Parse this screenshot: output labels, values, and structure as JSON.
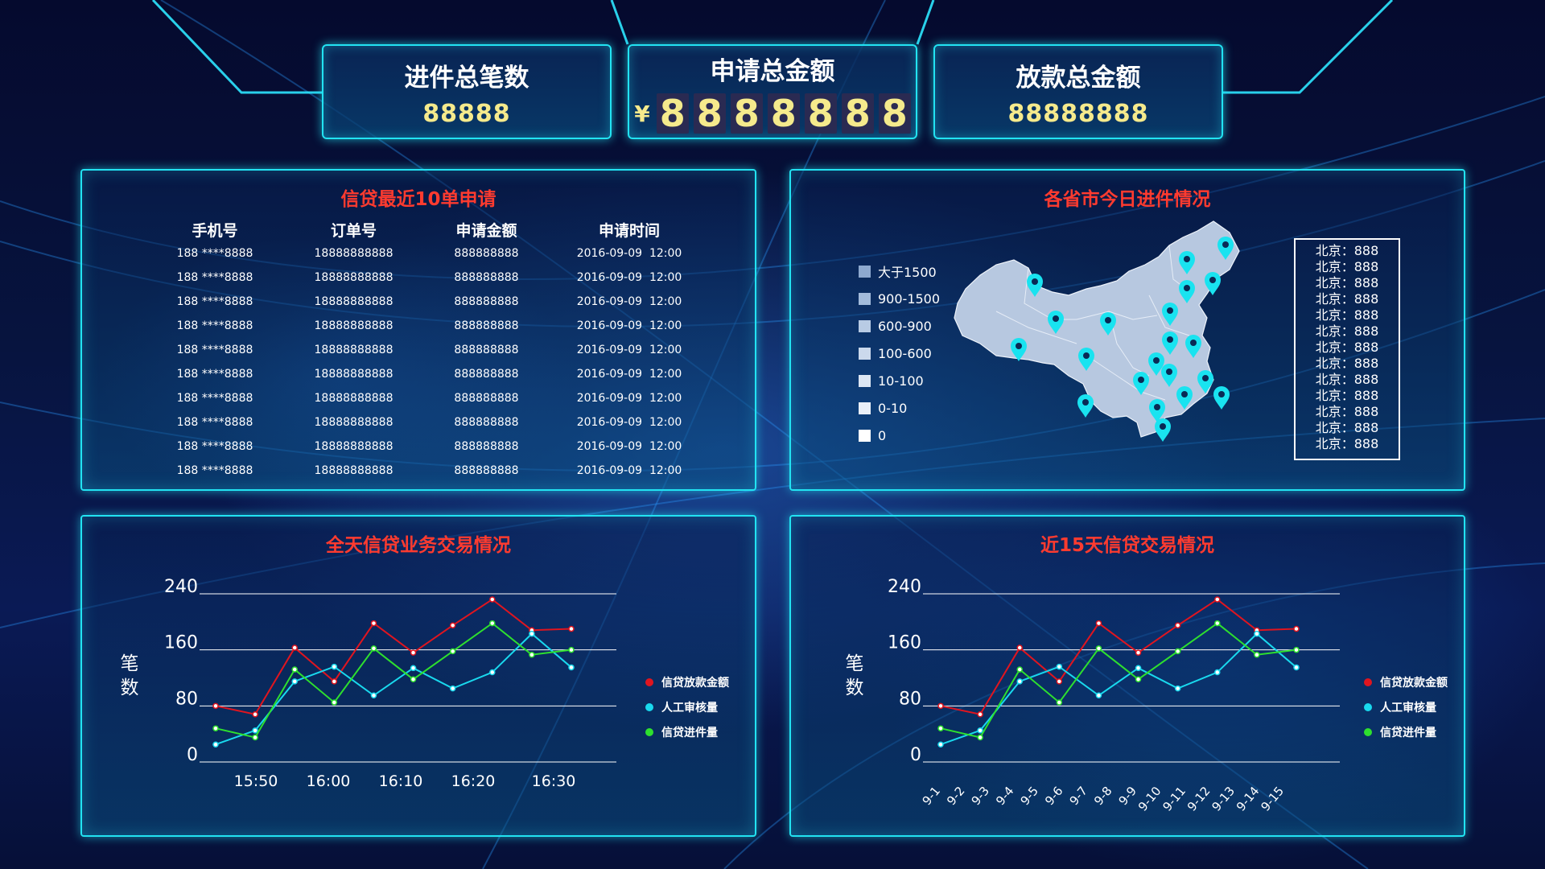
{
  "kpis": {
    "total_count": {
      "title": "进件总笔数",
      "value": "88888"
    },
    "apply_amount": {
      "title": "申请总金额",
      "currency": "¥",
      "digits": [
        "8",
        "8",
        "8",
        "8",
        "8",
        "8",
        "8"
      ]
    },
    "loan_amount": {
      "title": "放款总金额",
      "value": "88888888"
    }
  },
  "recent_table": {
    "title": "信贷最近10单申请",
    "headers": [
      "手机号",
      "订单号",
      "申请金额",
      "申请时间"
    ],
    "rows": [
      [
        "188 ****8888",
        "18888888888",
        "888888888",
        "2016-09-09  12:00"
      ],
      [
        "188 ****8888",
        "18888888888",
        "888888888",
        "2016-09-09  12:00"
      ],
      [
        "188 ****8888",
        "18888888888",
        "888888888",
        "2016-09-09  12:00"
      ],
      [
        "188 ****8888",
        "18888888888",
        "888888888",
        "2016-09-09  12:00"
      ],
      [
        "188 ****8888",
        "18888888888",
        "888888888",
        "2016-09-09  12:00"
      ],
      [
        "188 ****8888",
        "18888888888",
        "888888888",
        "2016-09-09  12:00"
      ],
      [
        "188 ****8888",
        "18888888888",
        "888888888",
        "2016-09-09  12:00"
      ],
      [
        "188 ****8888",
        "18888888888",
        "888888888",
        "2016-09-09  12:00"
      ],
      [
        "188 ****8888",
        "18888888888",
        "888888888",
        "2016-09-09  12:00"
      ],
      [
        "188 ****8888",
        "18888888888",
        "888888888",
        "2016-09-09  12:00"
      ]
    ]
  },
  "province_map": {
    "title": "各省市今日进件情况",
    "legend": [
      {
        "label": "大于1500",
        "color": "#8ea9cf"
      },
      {
        "label": "900-1500",
        "color": "#a3bbdb"
      },
      {
        "label": "600-900",
        "color": "#b8cbe4"
      },
      {
        "label": "100-600",
        "color": "#cbd9ec"
      },
      {
        "label": "10-100",
        "color": "#dce6f3"
      },
      {
        "label": "0-10",
        "color": "#eaf0f8"
      },
      {
        "label": "0",
        "color": "#ffffff"
      }
    ],
    "list": [
      "北京：888",
      "北京：888",
      "北京：888",
      "北京：888",
      "北京：888",
      "北京：888",
      "北京：888",
      "北京：888",
      "北京：888",
      "北京：888",
      "北京：888",
      "北京：888",
      "北京：888"
    ],
    "pin_icon": "map-pin-icon",
    "pin_color": "#19e3f0"
  },
  "chart_all_day": {
    "title": "全天信贷业务交易情况",
    "ylabel": "笔数",
    "legend": [
      "信贷放款金额",
      "人工审核量",
      "信贷进件量"
    ],
    "chart_data": {
      "type": "line",
      "title": "全天信贷业务交易情况",
      "ylabel": "笔数",
      "ylim": [
        0,
        240
      ],
      "yticks": [
        0,
        80,
        160,
        240
      ],
      "xtick_labels": [
        "15:50",
        "16:00",
        "16:10",
        "16:20",
        "16:30"
      ],
      "series": [
        {
          "name": "信贷放款金额",
          "color": "#e0151f",
          "values": [
            80,
            68,
            163,
            115,
            198,
            156,
            195,
            232,
            188,
            190
          ]
        },
        {
          "name": "人工审核量",
          "color": "#19d9ee",
          "values": [
            25,
            45,
            115,
            136,
            95,
            134,
            105,
            128,
            183,
            135
          ]
        },
        {
          "name": "信贷进件量",
          "color": "#2ee02e",
          "values": [
            48,
            35,
            132,
            85,
            162,
            118,
            158,
            198,
            153,
            160
          ]
        }
      ]
    }
  },
  "chart_15_days": {
    "title": "近15天信贷交易情况",
    "ylabel": "笔数",
    "legend": [
      "信贷放款金额",
      "人工审核量",
      "信贷进件量"
    ],
    "chart_data": {
      "type": "line",
      "title": "近15天信贷交易情况",
      "ylabel": "笔数",
      "ylim": [
        0,
        240
      ],
      "yticks": [
        0,
        80,
        160,
        240
      ],
      "categories": [
        "9-1",
        "9-2",
        "9-3",
        "9-4",
        "9-5",
        "9-6",
        "9-7",
        "9-8",
        "9-9",
        "9-10",
        "9-11",
        "9-12",
        "9-13",
        "9-14",
        "9-15"
      ],
      "series": [
        {
          "name": "信贷放款金额",
          "color": "#e0151f",
          "values": [
            80,
            68,
            163,
            115,
            198,
            156,
            195,
            232,
            188,
            190
          ]
        },
        {
          "name": "人工审核量",
          "color": "#19d9ee",
          "values": [
            25,
            45,
            115,
            136,
            95,
            134,
            105,
            128,
            183,
            135
          ]
        },
        {
          "name": "信贷进件量",
          "color": "#2ee02e",
          "values": [
            48,
            35,
            132,
            85,
            162,
            118,
            158,
            198,
            153,
            160
          ]
        }
      ]
    }
  }
}
